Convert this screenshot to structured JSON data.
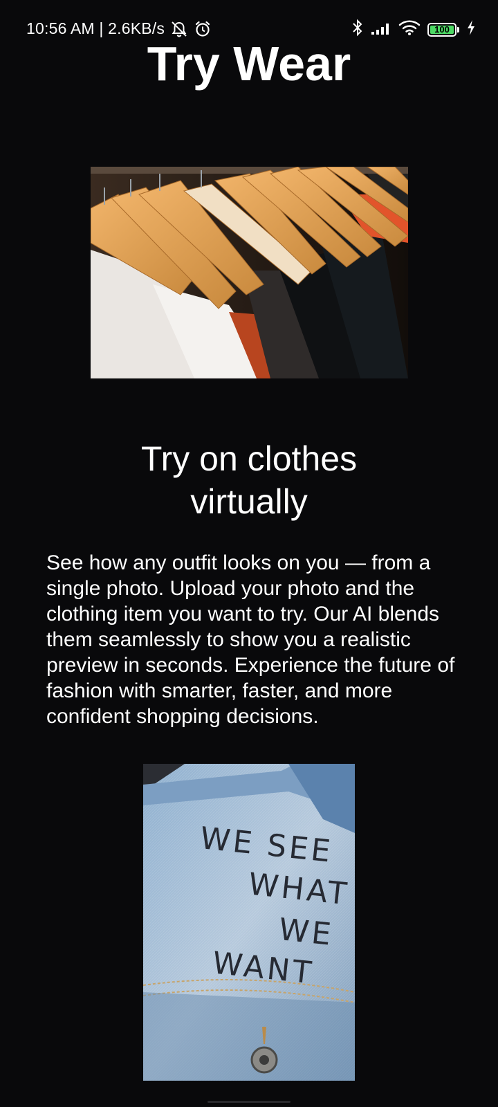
{
  "status_bar": {
    "time_and_speed": "10:56 AM | 2.6KB/s",
    "battery_level": "100",
    "battery_fraction": 1.0,
    "icons": [
      "silent-bell-icon",
      "alarm-icon",
      "bluetooth-icon",
      "signal-icon",
      "wifi-icon",
      "battery-icon",
      "charging-icon"
    ]
  },
  "app": {
    "title": "Try Wear"
  },
  "hero": {
    "headline_line1": "Try on clothes",
    "headline_line2": "virtually",
    "description": "See how any outfit looks on you — from a single photo. Upload your photo and the clothing item you want to try. Our AI blends them seamlessly to show you a realistic preview in seconds. Experience the future of fashion with smarter, faster, and more confident shopping decisions."
  },
  "jacket_photo": {
    "printed_words": [
      "WE SEE",
      "WHAT",
      "WE",
      "WANT"
    ]
  },
  "colors": {
    "background": "#09090b",
    "text": "#ffffff",
    "battery_green": "#4cd964"
  }
}
